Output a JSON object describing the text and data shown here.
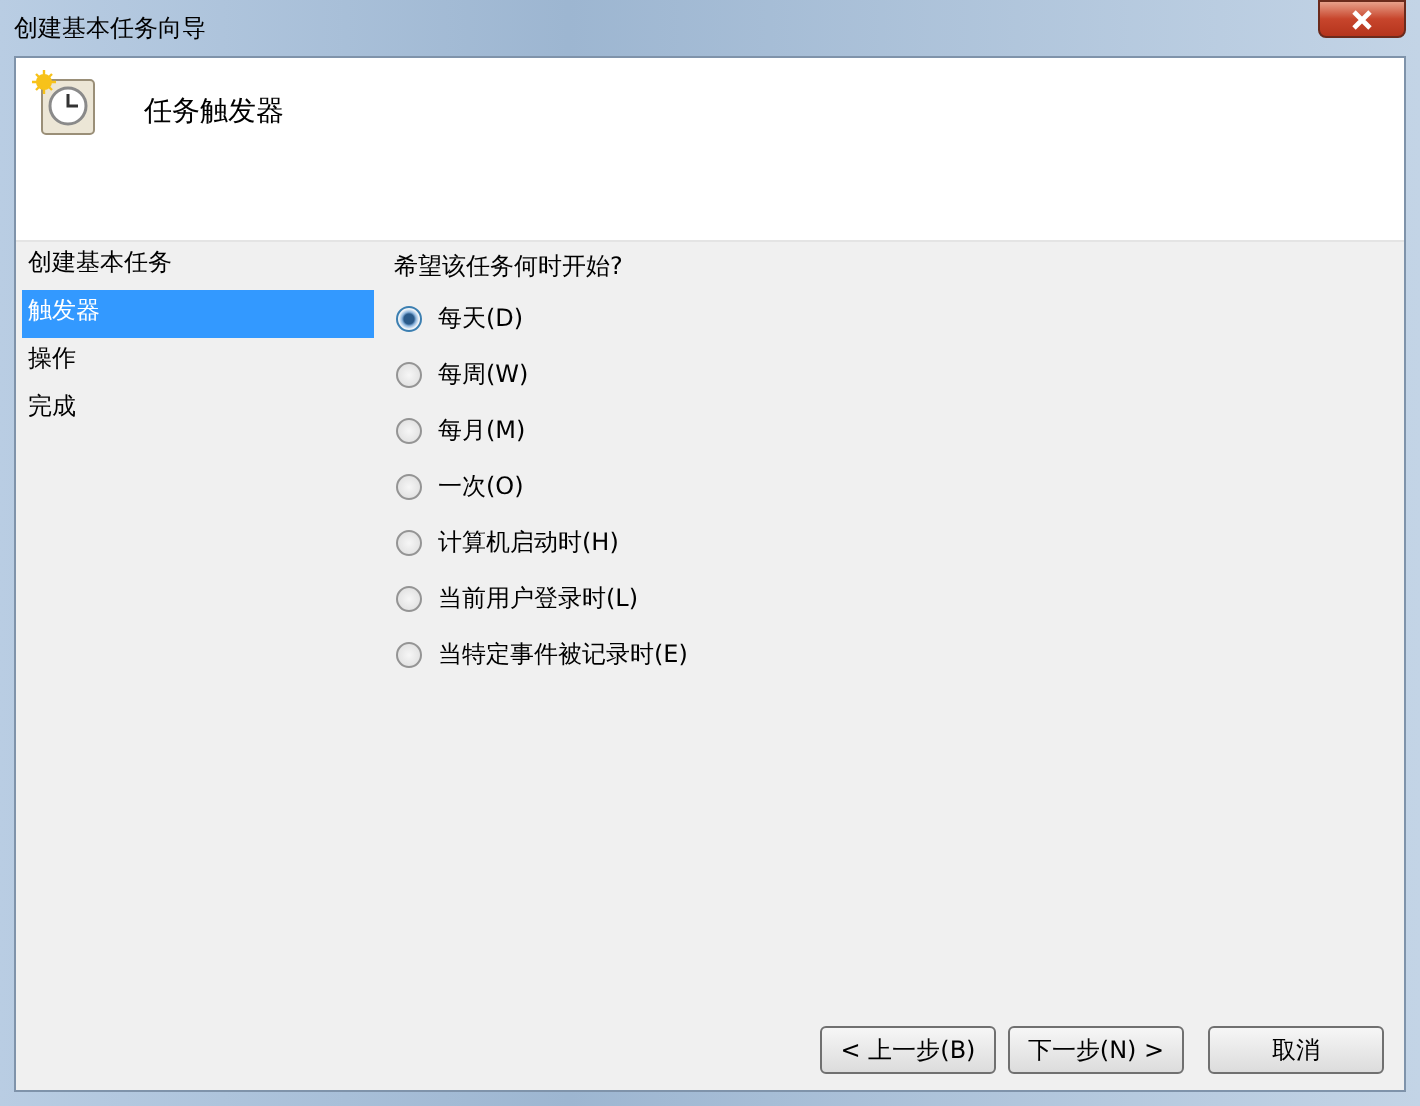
{
  "window": {
    "title": "创建基本任务向导"
  },
  "header": {
    "title": "任务触发器"
  },
  "sidebar": {
    "items": [
      {
        "label": "创建基本任务",
        "selected": false
      },
      {
        "label": "触发器",
        "selected": true
      },
      {
        "label": "操作",
        "selected": false
      },
      {
        "label": "完成",
        "selected": false
      }
    ]
  },
  "question": "希望该任务何时开始?",
  "options": [
    {
      "label": "每天(D)",
      "selected": true
    },
    {
      "label": "每周(W)",
      "selected": false
    },
    {
      "label": "每月(M)",
      "selected": false
    },
    {
      "label": "一次(O)",
      "selected": false
    },
    {
      "label": "计算机启动时(H)",
      "selected": false
    },
    {
      "label": "当前用户登录时(L)",
      "selected": false
    },
    {
      "label": "当特定事件被记录时(E)",
      "selected": false
    }
  ],
  "buttons": [
    {
      "label": "< 上一步(B)"
    },
    {
      "label": "下一步(N) >"
    },
    {
      "label": "取消"
    }
  ]
}
